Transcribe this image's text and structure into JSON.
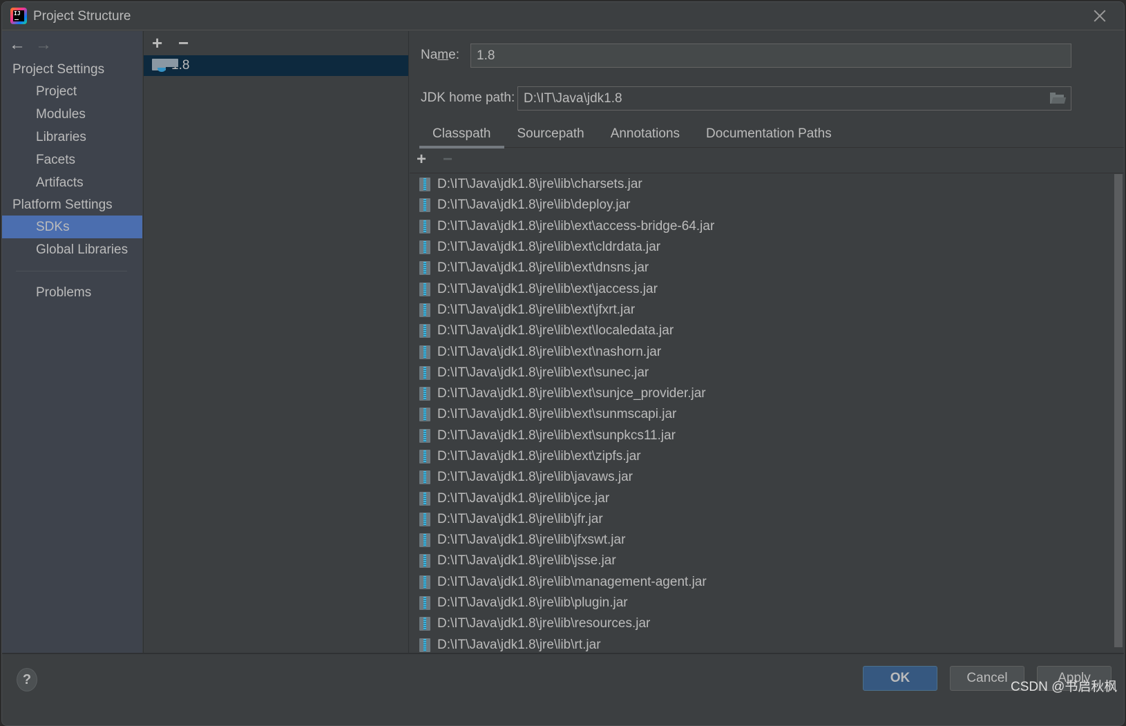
{
  "window": {
    "title": "Project Structure",
    "app_icon_text": "IJ"
  },
  "sidebar": {
    "back_arrow": "←",
    "forward_arrow": "→",
    "sections": [
      {
        "label": "Project Settings",
        "items": [
          "Project",
          "Modules",
          "Libraries",
          "Facets",
          "Artifacts"
        ]
      },
      {
        "label": "Platform Settings",
        "items": [
          "SDKs",
          "Global Libraries"
        ]
      }
    ],
    "selected_item": "SDKs",
    "problems_label": "Problems"
  },
  "sdk_panel": {
    "add_label": "+",
    "remove_label": "−",
    "sdks": [
      {
        "name": "1.8",
        "selected": true
      }
    ]
  },
  "detail": {
    "name_label_pre": "Na",
    "name_label_mnemonic": "m",
    "name_label_post": "e:",
    "name_value": "1.8",
    "jdk_home_label": "JDK home path:",
    "jdk_home_value": "D:\\IT\\Java\\jdk1.8",
    "tabs": [
      "Classpath",
      "Sourcepath",
      "Annotations",
      "Documentation Paths"
    ],
    "active_tab": "Classpath",
    "classpath_add": "+",
    "classpath_remove": "−",
    "classpath": [
      "D:\\IT\\Java\\jdk1.8\\jre\\lib\\charsets.jar",
      "D:\\IT\\Java\\jdk1.8\\jre\\lib\\deploy.jar",
      "D:\\IT\\Java\\jdk1.8\\jre\\lib\\ext\\access-bridge-64.jar",
      "D:\\IT\\Java\\jdk1.8\\jre\\lib\\ext\\cldrdata.jar",
      "D:\\IT\\Java\\jdk1.8\\jre\\lib\\ext\\dnsns.jar",
      "D:\\IT\\Java\\jdk1.8\\jre\\lib\\ext\\jaccess.jar",
      "D:\\IT\\Java\\jdk1.8\\jre\\lib\\ext\\jfxrt.jar",
      "D:\\IT\\Java\\jdk1.8\\jre\\lib\\ext\\localedata.jar",
      "D:\\IT\\Java\\jdk1.8\\jre\\lib\\ext\\nashorn.jar",
      "D:\\IT\\Java\\jdk1.8\\jre\\lib\\ext\\sunec.jar",
      "D:\\IT\\Java\\jdk1.8\\jre\\lib\\ext\\sunjce_provider.jar",
      "D:\\IT\\Java\\jdk1.8\\jre\\lib\\ext\\sunmscapi.jar",
      "D:\\IT\\Java\\jdk1.8\\jre\\lib\\ext\\sunpkcs11.jar",
      "D:\\IT\\Java\\jdk1.8\\jre\\lib\\ext\\zipfs.jar",
      "D:\\IT\\Java\\jdk1.8\\jre\\lib\\javaws.jar",
      "D:\\IT\\Java\\jdk1.8\\jre\\lib\\jce.jar",
      "D:\\IT\\Java\\jdk1.8\\jre\\lib\\jfr.jar",
      "D:\\IT\\Java\\jdk1.8\\jre\\lib\\jfxswt.jar",
      "D:\\IT\\Java\\jdk1.8\\jre\\lib\\jsse.jar",
      "D:\\IT\\Java\\jdk1.8\\jre\\lib\\management-agent.jar",
      "D:\\IT\\Java\\jdk1.8\\jre\\lib\\plugin.jar",
      "D:\\IT\\Java\\jdk1.8\\jre\\lib\\resources.jar",
      "D:\\IT\\Java\\jdk1.8\\jre\\lib\\rt.jar"
    ]
  },
  "footer": {
    "help_label": "?",
    "ok_label": "OK",
    "cancel_label": "Cancel",
    "apply_label": "Apply",
    "watermark": "CSDN @书启秋枫"
  },
  "colors": {
    "selection_sidebar": "#4b6eaf",
    "selection_sdk": "#0d293e",
    "ok_button": "#365880",
    "background": "#3c3f41"
  }
}
